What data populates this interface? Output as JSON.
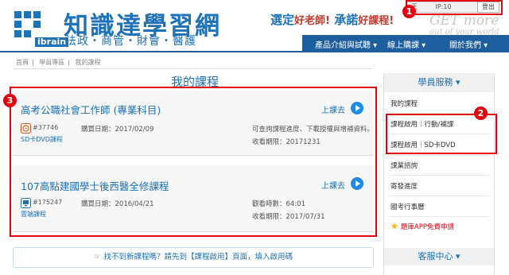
{
  "header": {
    "brand_name": "知識達學習網",
    "brand_tagline": "法政・商管・財會・醫護",
    "logo_text": "ibrain",
    "slogan_a": "選定",
    "slogan_a_small": "好老師!",
    "slogan_b": "承諾",
    "slogan_b_small": "好課程!",
    "get_more": "GET more",
    "get_more_sub": "out of your world",
    "user_info": "王",
    "ip_info": "IP:10",
    "logout_label": "登出"
  },
  "nav": {
    "items": [
      {
        "label": "產品介紹與試聽 ▾"
      },
      {
        "label": "線上購課 ▾"
      },
      {
        "label": "關於我們 ▾"
      }
    ]
  },
  "breadcrumb": [
    "首頁",
    "學員專區",
    "我的課程"
  ],
  "page_title": "我的課程",
  "courses": [
    {
      "title": "高考公職社會工作師 (專業科目)",
      "go_label": "上課去",
      "code": "#37746",
      "type": "SD卡DVD課程",
      "purchase_date": "購買日期：2017/02/09",
      "note": "可查詢課程進度、下載授權與增補資料。",
      "expire": "收看期限：20171231"
    },
    {
      "title": "107高點建國學士後西醫全修課程",
      "go_label": "上課去",
      "code": "#175247",
      "type": "雲端課程",
      "purchase_date": "購買日期：2016/04/21",
      "watch_time": "觀看時數：64:01",
      "expire": "收看期限：2017/07/31"
    }
  ],
  "help_bar": {
    "text": "找不到新課程嗎？請先到【課程啟用】頁面，填入啟用碼"
  },
  "sidebar": {
    "header": "學員服務 ▾",
    "items": [
      {
        "label": "我的課程"
      },
      {
        "label": "課程啟用｜行動/補課"
      },
      {
        "label": "課程啟用｜SD卡DVD"
      },
      {
        "label": "課業諮詢"
      },
      {
        "label": "寄發進度"
      },
      {
        "label": "國考行事曆"
      },
      {
        "label": "題庫APP免費申請"
      }
    ],
    "footer": "客服中心 ▾"
  },
  "annotations": [
    "1",
    "2",
    "3"
  ],
  "colors": {
    "brand_blue": "#1d72b8",
    "nav_blue": "#1d5f9e",
    "annotation_red": "#e3000f"
  }
}
